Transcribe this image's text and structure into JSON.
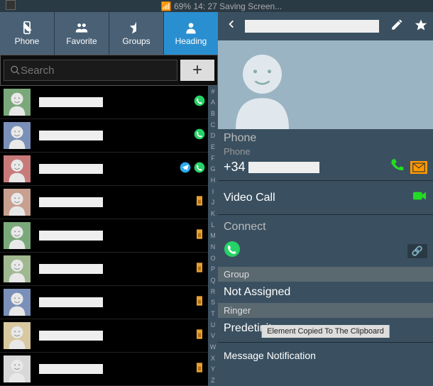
{
  "status": {
    "battery": "69%",
    "time": "14: 27",
    "activity": "Saving Screen..."
  },
  "tabs": [
    {
      "key": "phone",
      "label": "Phone"
    },
    {
      "key": "favorite",
      "label": "Favorite"
    },
    {
      "key": "groups",
      "label": "Groups"
    },
    {
      "key": "heading",
      "label": "Heading"
    }
  ],
  "search": {
    "placeholder": "Search"
  },
  "contacts": [
    {
      "avatarBg": "#7aa87a",
      "icons": [
        "whatsapp"
      ]
    },
    {
      "avatarBg": "#7a90b8",
      "icons": [
        "whatsapp"
      ]
    },
    {
      "avatarBg": "#c87a7a",
      "icons": [
        "telegram",
        "whatsapp"
      ]
    },
    {
      "avatarBg": "#c8a090",
      "icons": [
        "sim"
      ]
    },
    {
      "avatarBg": "#7aa87a",
      "icons": [
        "sim"
      ]
    },
    {
      "avatarBg": "#a0b890",
      "icons": [
        "sim"
      ]
    },
    {
      "avatarBg": "#7a90b8",
      "icons": [
        "sim"
      ]
    },
    {
      "avatarBg": "#d8c8a0",
      "icons": [
        "sim"
      ]
    },
    {
      "avatarBg": "#d8d8d8",
      "icons": [
        "sim"
      ]
    }
  ],
  "alphaIndex": [
    "#",
    "A",
    "B",
    "C",
    "D",
    "E",
    "F",
    "G",
    "H",
    "I",
    "J",
    "K",
    "L",
    "M",
    "N",
    "O",
    "P",
    "Q",
    "R",
    "S",
    "T",
    "U",
    "V",
    "W",
    "X",
    "Y",
    "Z"
  ],
  "detail": {
    "section1_title": "Phone",
    "phone_label": "Phone",
    "phone_prefix": "+34",
    "video_call": "Video Call",
    "connect": "Connect",
    "group_header": "Group",
    "group_value": "Not Assigned",
    "ringer_header": "Ringer",
    "ringer_value": "Predetinite",
    "msg_notif": "Message Notification"
  },
  "toast": "Element Copied To The Clipboard"
}
